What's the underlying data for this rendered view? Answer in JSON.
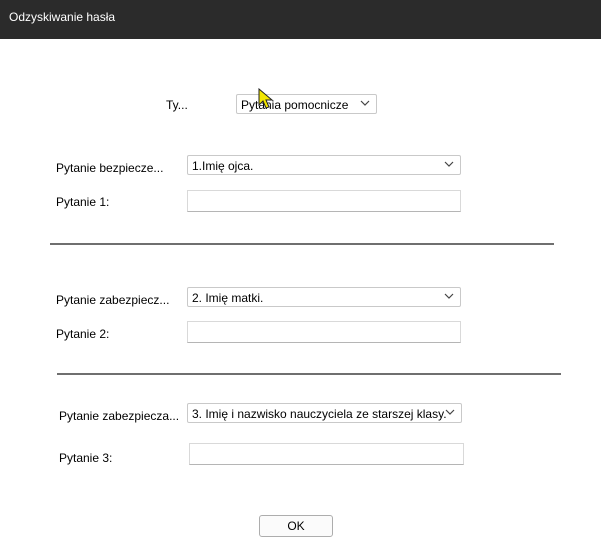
{
  "window": {
    "title": "Odzyskiwanie hasła"
  },
  "type_row": {
    "label": "Ty...",
    "value": "Pytania pomocnicze"
  },
  "sections": [
    {
      "question_label": "Pytanie bezpiecze...",
      "question_value": "1.Imię ojca.",
      "answer_label": "Pytanie 1:",
      "answer_value": ""
    },
    {
      "question_label": "Pytanie zabezpiecz...",
      "question_value": "2. Imię matki.",
      "answer_label": "Pytanie 2:",
      "answer_value": ""
    },
    {
      "question_label": "Pytanie zabezpiecza...",
      "question_value": "3. Imię i nazwisko nauczyciela ze starszej klasy.",
      "answer_label": "Pytanie 3:",
      "answer_value": ""
    }
  ],
  "buttons": {
    "ok": "OK"
  },
  "colors": {
    "titlebar": "#2b2b2b",
    "separator": "#6f6f6f"
  }
}
